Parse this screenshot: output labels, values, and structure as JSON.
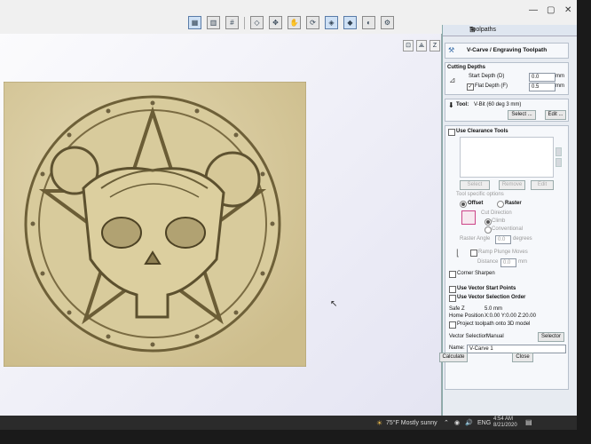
{
  "panel": {
    "title": "Toolpaths",
    "header": "V-Carve / Engraving Toolpath",
    "cutting_depths": {
      "title": "Cutting Depths",
      "start_depth_label": "Start Depth (D)",
      "start_depth_value": "0.0",
      "start_unit": "mm",
      "flat_depth_label": "Flat Depth (F)",
      "flat_depth_value": "0.5",
      "flat_unit": "mm"
    },
    "tool": {
      "label": "Tool:",
      "value": "V-Bit (60 deg 3 mm)",
      "select": "Select ...",
      "edit": "Edit ..."
    },
    "clearance": {
      "title": "Use Clearance Tools",
      "select": "Select",
      "remove": "Remove",
      "edit": "Edit"
    },
    "options": {
      "title": "Tool specific options",
      "offset": "Offset",
      "raster": "Raster",
      "cut_direction": "Cut Direction",
      "climb": "Climb",
      "conventional": "Conventional",
      "raster_angle_label": "Raster Angle",
      "raster_angle_value": "0.0",
      "raster_angle_unit": "degrees",
      "ramp": "Ramp Plunge Moves",
      "distance_label": "Distance",
      "distance_value": "0.0",
      "distance_unit": "mm",
      "corner": "Corner Sharpen"
    },
    "vector": {
      "start_points": "Use Vector Start Points",
      "selection_order": "Use Vector Selection Order"
    },
    "info": {
      "safe_z_label": "Safe Z",
      "safe_z_value": "5.0 mm",
      "home_label": "Home Position",
      "home_value": "X:0.00 Y:0.00 Z:20.00",
      "project": "Project toolpath onto 3D model"
    },
    "selection": {
      "label": "Vector Selection:",
      "value": "Manual",
      "button": "Selector"
    },
    "name": {
      "label": "Name:",
      "value": "V-Carve 1"
    },
    "calculate": "Calculate",
    "close": "Close"
  },
  "taskbar": {
    "weather": "75°F  Mostly sunny",
    "lang": "ENG",
    "time": "4:54 AM",
    "date": "8/21/2020"
  }
}
